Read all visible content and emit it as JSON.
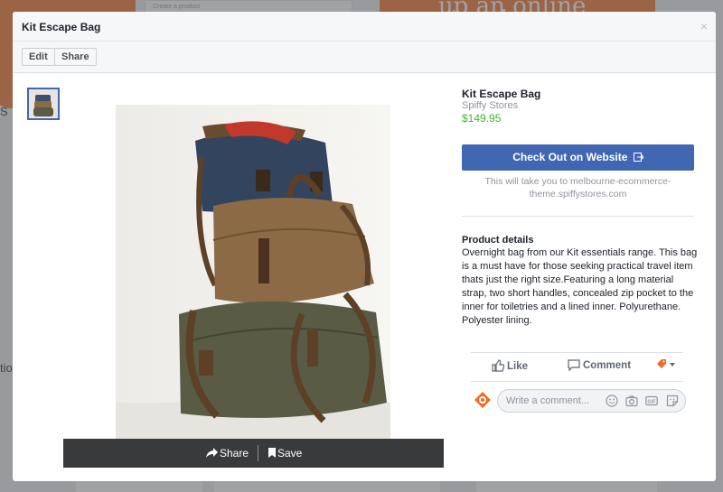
{
  "background": {
    "banner_text": "up an online store!",
    "side_texts": [
      "S",
      "tio"
    ],
    "small_caption": "Create a product"
  },
  "modal": {
    "title": "Kit Escape Bag",
    "close_glyph": "×",
    "toolbar": {
      "edit_label": "Edit",
      "share_label": "Share"
    }
  },
  "product": {
    "name": "Kit Escape Bag",
    "store": "Spiffy Stores",
    "price": "$149.95",
    "checkout_label": "Check Out on Website",
    "redirect_note": "This will take you to melbourne-ecommerce-theme.spiffystores.com",
    "details_heading": "Product details",
    "details_text": "Overnight bag from our Kit essentials range. This bag is a must have for those seeking practical travel item thats just the right size.Featuring a long material strap, two short handles, concealed zip pocket to the inner for toiletries and a lined inner. Polyurethane. Polyester lining."
  },
  "photo_bar": {
    "share_label": "Share",
    "save_label": "Save"
  },
  "actions": {
    "like_label": "Like",
    "comment_label": "Comment"
  },
  "comment": {
    "placeholder": "Write a comment..."
  },
  "colors": {
    "brand_blue": "#4267b2",
    "price_green": "#42b72a",
    "accent_orange": "#f36b21"
  },
  "icons": [
    "share-arrow-icon",
    "bookmark-icon",
    "external-link-icon",
    "like-icon",
    "comment-icon",
    "page-selector-icon",
    "emoji-icon",
    "camera-icon",
    "gif-icon",
    "sticker-icon",
    "close-icon"
  ]
}
